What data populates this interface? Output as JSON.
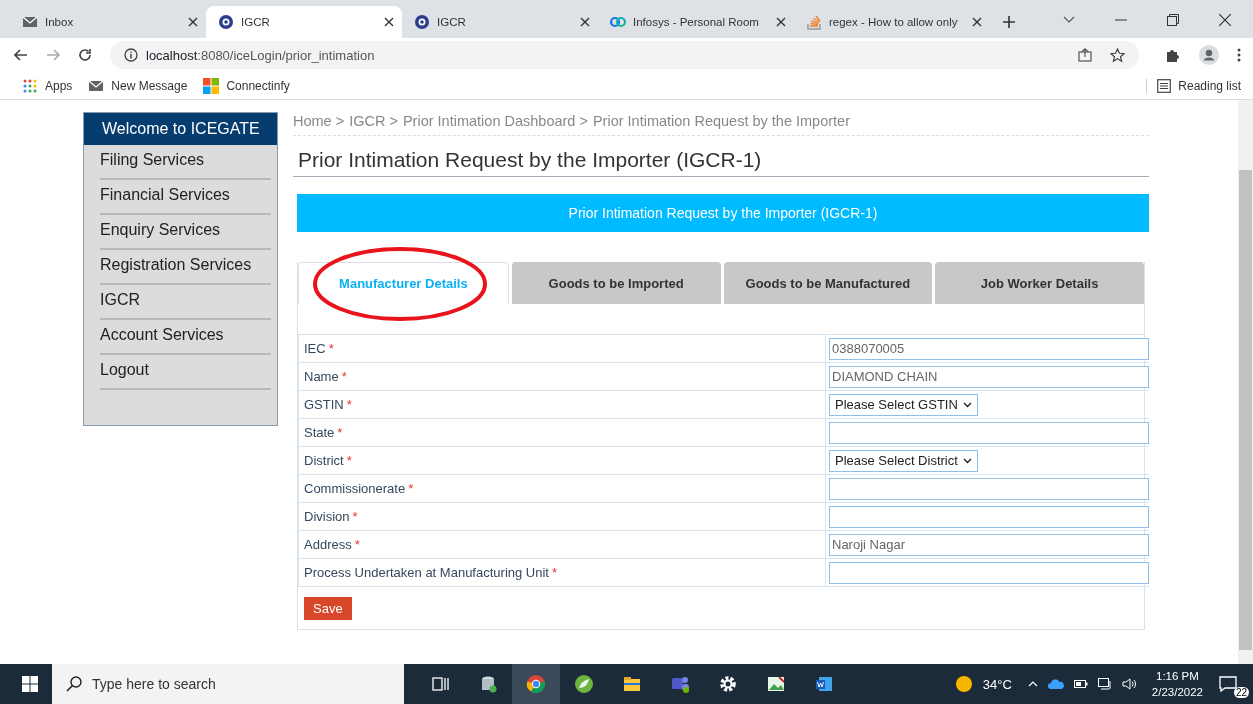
{
  "browser": {
    "tabs": [
      {
        "title": "Inbox",
        "selected": false
      },
      {
        "title": "IGCR",
        "selected": true
      },
      {
        "title": "IGCR",
        "selected": false
      },
      {
        "title": "Infosys - Personal Room",
        "selected": false
      },
      {
        "title": "regex - How to allow only",
        "selected": false
      }
    ],
    "address": {
      "host": "localhost",
      "rest": ":8080/iceLogin/prior_intimation"
    },
    "bookmarks": [
      {
        "label": "Apps"
      },
      {
        "label": "New Message"
      },
      {
        "label": "Connectinfy"
      }
    ],
    "reading_list": "Reading list"
  },
  "sidebar": {
    "title": "Welcome to ICEGATE",
    "items": [
      {
        "label": "Filing Services"
      },
      {
        "label": "Financial Services"
      },
      {
        "label": "Enquiry Services"
      },
      {
        "label": "Registration Services"
      },
      {
        "label": "IGCR"
      },
      {
        "label": "Account Services"
      },
      {
        "label": "Logout"
      }
    ]
  },
  "breadcrumb": [
    "Home >",
    "IGCR >",
    "Prior Intimation Dashboard >",
    "Prior Intimation Request by the Importer"
  ],
  "page_title": "Prior Intimation Request by the Importer (IGCR-1)",
  "banner": "Prior Intimation Request by the Importer (IGCR-1)",
  "form_tabs": [
    {
      "label": "Manufacturer Details",
      "selected": true,
      "circled": true
    },
    {
      "label": "Goods to be Imported",
      "selected": false,
      "circled": false
    },
    {
      "label": "Goods to be Manufactured",
      "selected": false,
      "circled": false
    },
    {
      "label": "Job Worker Details",
      "selected": false,
      "circled": false
    }
  ],
  "fields": [
    {
      "label": "IEC",
      "required_mark": "*",
      "kind": "text",
      "value": "0388070005"
    },
    {
      "label": "Name",
      "required_mark": "*",
      "kind": "text",
      "value": "DIAMOND CHAIN"
    },
    {
      "label": "GSTIN",
      "required_mark": "*",
      "kind": "select",
      "value": "Please Select GSTIN"
    },
    {
      "label": "State",
      "required_mark": "*",
      "kind": "text"
    },
    {
      "label": "District",
      "required_mark": "*",
      "kind": "select",
      "value": "Please Select District"
    },
    {
      "label": "Commissionerate",
      "required_mark": "*",
      "kind": "text"
    },
    {
      "label": "Division",
      "required_mark": "*",
      "kind": "text"
    },
    {
      "label": "Address",
      "required_mark": "*",
      "kind": "text",
      "value": "Naroji Nagar"
    },
    {
      "label": "Process Undertaken at Manufacturing Unit",
      "required_mark": "*",
      "kind": "text"
    }
  ],
  "save_button": "Save",
  "taskbar": {
    "search_placeholder": "Type here to search",
    "temperature": "34°C",
    "time": "1:16 PM",
    "date": "2/23/2022",
    "notifications": "22"
  }
}
